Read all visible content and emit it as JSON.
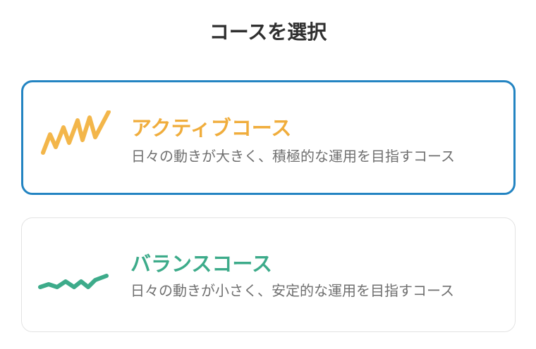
{
  "page": {
    "title": "コースを選択"
  },
  "courses": [
    {
      "name": "アクティブコース",
      "description": "日々の動きが大きく、積極的な運用を目指すコース",
      "icon": "zigzag-chart-icon",
      "color": "#f0ad3c",
      "selected": true
    },
    {
      "name": "バランスコース",
      "description": "日々の動きが小さく、安定的な運用を目指すコース",
      "icon": "wave-line-icon",
      "color": "#3dab8a",
      "selected": false
    }
  ],
  "colors": {
    "selected_border": "#2384c2",
    "card_border": "#e3e3e3",
    "title_text": "#2f2f2f",
    "description_text": "#6f6f6f"
  }
}
